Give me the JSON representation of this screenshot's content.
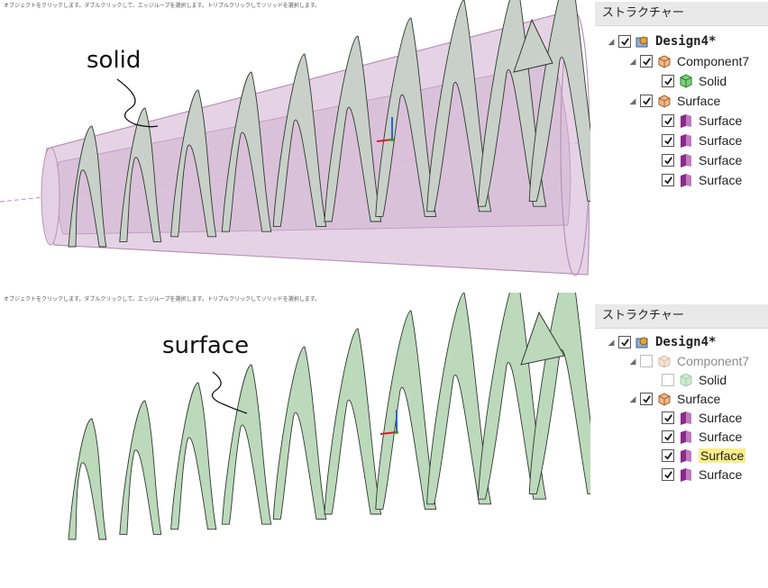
{
  "status_hint_top": "オブジェクトをクリックします。ダブルクリックして、エッジループを選択します。トリプルクリックしてソリッドを選択します。",
  "status_hint_bottom": "オブジェクトをクリックします。ダブルクリックして、エッジループを選択します。トリプルクリックしてソリッドを選択します。",
  "callout_top": "solid",
  "callout_bottom": "surface",
  "structure_title": "ストラクチャー",
  "tree_top": {
    "root": "Design4*",
    "component": "Component7",
    "solid": "Solid",
    "surface_group": "Surface",
    "surfaces": [
      "Surface",
      "Surface",
      "Surface",
      "Surface"
    ]
  },
  "tree_bottom": {
    "root": "Design4*",
    "component": "Component7",
    "solid": "Solid",
    "surface_group": "Surface",
    "surfaces": [
      "Surface",
      "Surface",
      "Surface",
      "Surface"
    ],
    "highlighted_index": 2
  },
  "colors": {
    "solid_fill": "#dcc4dc",
    "solid_edge": "#b893b8",
    "helix_fill_top": "#c9d0c9",
    "helix_fill_bottom": "#bcd9bc",
    "helix_edge": "#2f3a2f",
    "highlight": "#f9ec8a",
    "check": "#1a1a1a"
  }
}
